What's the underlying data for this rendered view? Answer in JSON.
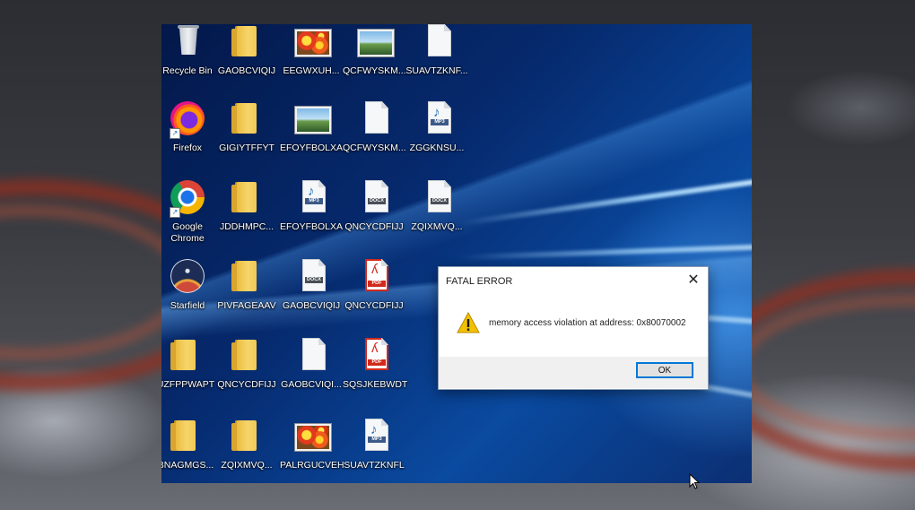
{
  "desktop": {
    "icons": [
      {
        "label": "Recycle Bin",
        "icon": "recycle-bin-icon"
      },
      {
        "label": "GAOBCVIQIJ",
        "icon": "folder-icon"
      },
      {
        "label": "EEGWXUH...",
        "icon": "image-icon"
      },
      {
        "label": "QCFWYSKM...",
        "icon": "image-icon"
      },
      {
        "label": "SUAVTZKNF...",
        "icon": "document-icon"
      },
      {
        "label": "Firefox",
        "icon": "firefox-icon"
      },
      {
        "label": "GIGIYTFFYT",
        "icon": "folder-icon"
      },
      {
        "label": "EFOYFBOLXA",
        "icon": "image-icon"
      },
      {
        "label": "QCFWYSKM...",
        "icon": "document-icon"
      },
      {
        "label": "ZGGKNSU...",
        "icon": "mp3-file-icon"
      },
      {
        "label": "Google Chrome",
        "icon": "chrome-icon"
      },
      {
        "label": "JDDHMPC...",
        "icon": "folder-icon"
      },
      {
        "label": "EFOYFBOLXA",
        "icon": "mp3-file-icon"
      },
      {
        "label": "QNCYCDFIJJ",
        "icon": "docx-file-icon"
      },
      {
        "label": "ZQIXMVQ...",
        "icon": "docx-file-icon"
      },
      {
        "label": "Starfield",
        "icon": "starfield-icon"
      },
      {
        "label": "PIVFAGEAAV",
        "icon": "folder-icon"
      },
      {
        "label": "GAOBCVIQIJ",
        "icon": "docx-file-icon"
      },
      {
        "label": "QNCYCDFIJJ",
        "icon": "pdf-file-icon"
      },
      {
        "label": "UZFPPWAPT",
        "icon": "folder-icon"
      },
      {
        "label": "QNCYCDFIJJ",
        "icon": "folder-icon"
      },
      {
        "label": "GAOBCVIQI...",
        "icon": "document-icon"
      },
      {
        "label": "SQSJKEBWDT",
        "icon": "pdf-file-icon"
      },
      {
        "label": "BNAGMGS...",
        "icon": "folder-icon"
      },
      {
        "label": "ZQIXMVQ...",
        "icon": "folder-icon"
      },
      {
        "label": "PALRGUCVEH",
        "icon": "image-icon"
      },
      {
        "label": "SUAVTZKNFL",
        "icon": "mp3-file-icon"
      }
    ]
  },
  "file_tags": {
    "docx": "DOCX",
    "pdf": "PDF",
    "mp3": "MP3"
  },
  "dialog": {
    "title": "FATAL ERROR",
    "close_glyph": "✕",
    "message": "memory access violation at address: 0x80070002",
    "ok_label": "OK",
    "icon": "warning-icon"
  },
  "colors": {
    "accent": "#0078d7",
    "warning": "#f2c200",
    "desktop_blue": "#062a6e"
  }
}
